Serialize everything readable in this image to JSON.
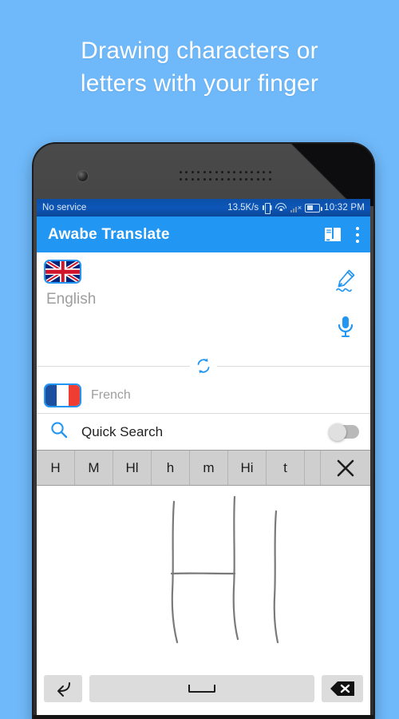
{
  "promo": {
    "line1": "Drawing characters or",
    "line2": "letters with your finger"
  },
  "colors": {
    "background": "#6fb9fa",
    "appbar": "#2196f3",
    "statusbar": "#0d57b8",
    "accent": "#2196f3",
    "candidate_strip": "#cfcfcf",
    "key": "#dcdcdc",
    "ink": "#7a7a7a"
  },
  "statusbar": {
    "carrier": "No service",
    "network_speed": "13.5K/s",
    "icons": [
      "vibrate-icon",
      "wifi-icon",
      "signal-off-icon",
      "battery-icon"
    ],
    "time": "10:32 PM"
  },
  "appbar": {
    "title": "Awabe Translate",
    "dictionary_icon": "book-icon",
    "overflow_icon": "overflow-menu-icon"
  },
  "translate": {
    "source": {
      "flag": "uk-flag",
      "placeholder": "English",
      "value": "",
      "handwriting_icon": "pen-icon",
      "mic_icon": "microphone-icon"
    },
    "swap_icon": "swap-languages-icon",
    "target": {
      "flag": "france-flag",
      "label": "French"
    }
  },
  "quick_search": {
    "search_icon": "search-icon",
    "label": "Quick Search",
    "enabled": false
  },
  "handwriting": {
    "candidates": [
      "H",
      "M",
      "Hl",
      "h",
      "m",
      "Hi",
      "t"
    ],
    "close_icon": "close-icon",
    "drawn_text": "HI",
    "keys": {
      "enter_icon": "enter-key-icon",
      "space_label": "space-key-icon",
      "delete_icon": "backspace-key-icon"
    }
  }
}
